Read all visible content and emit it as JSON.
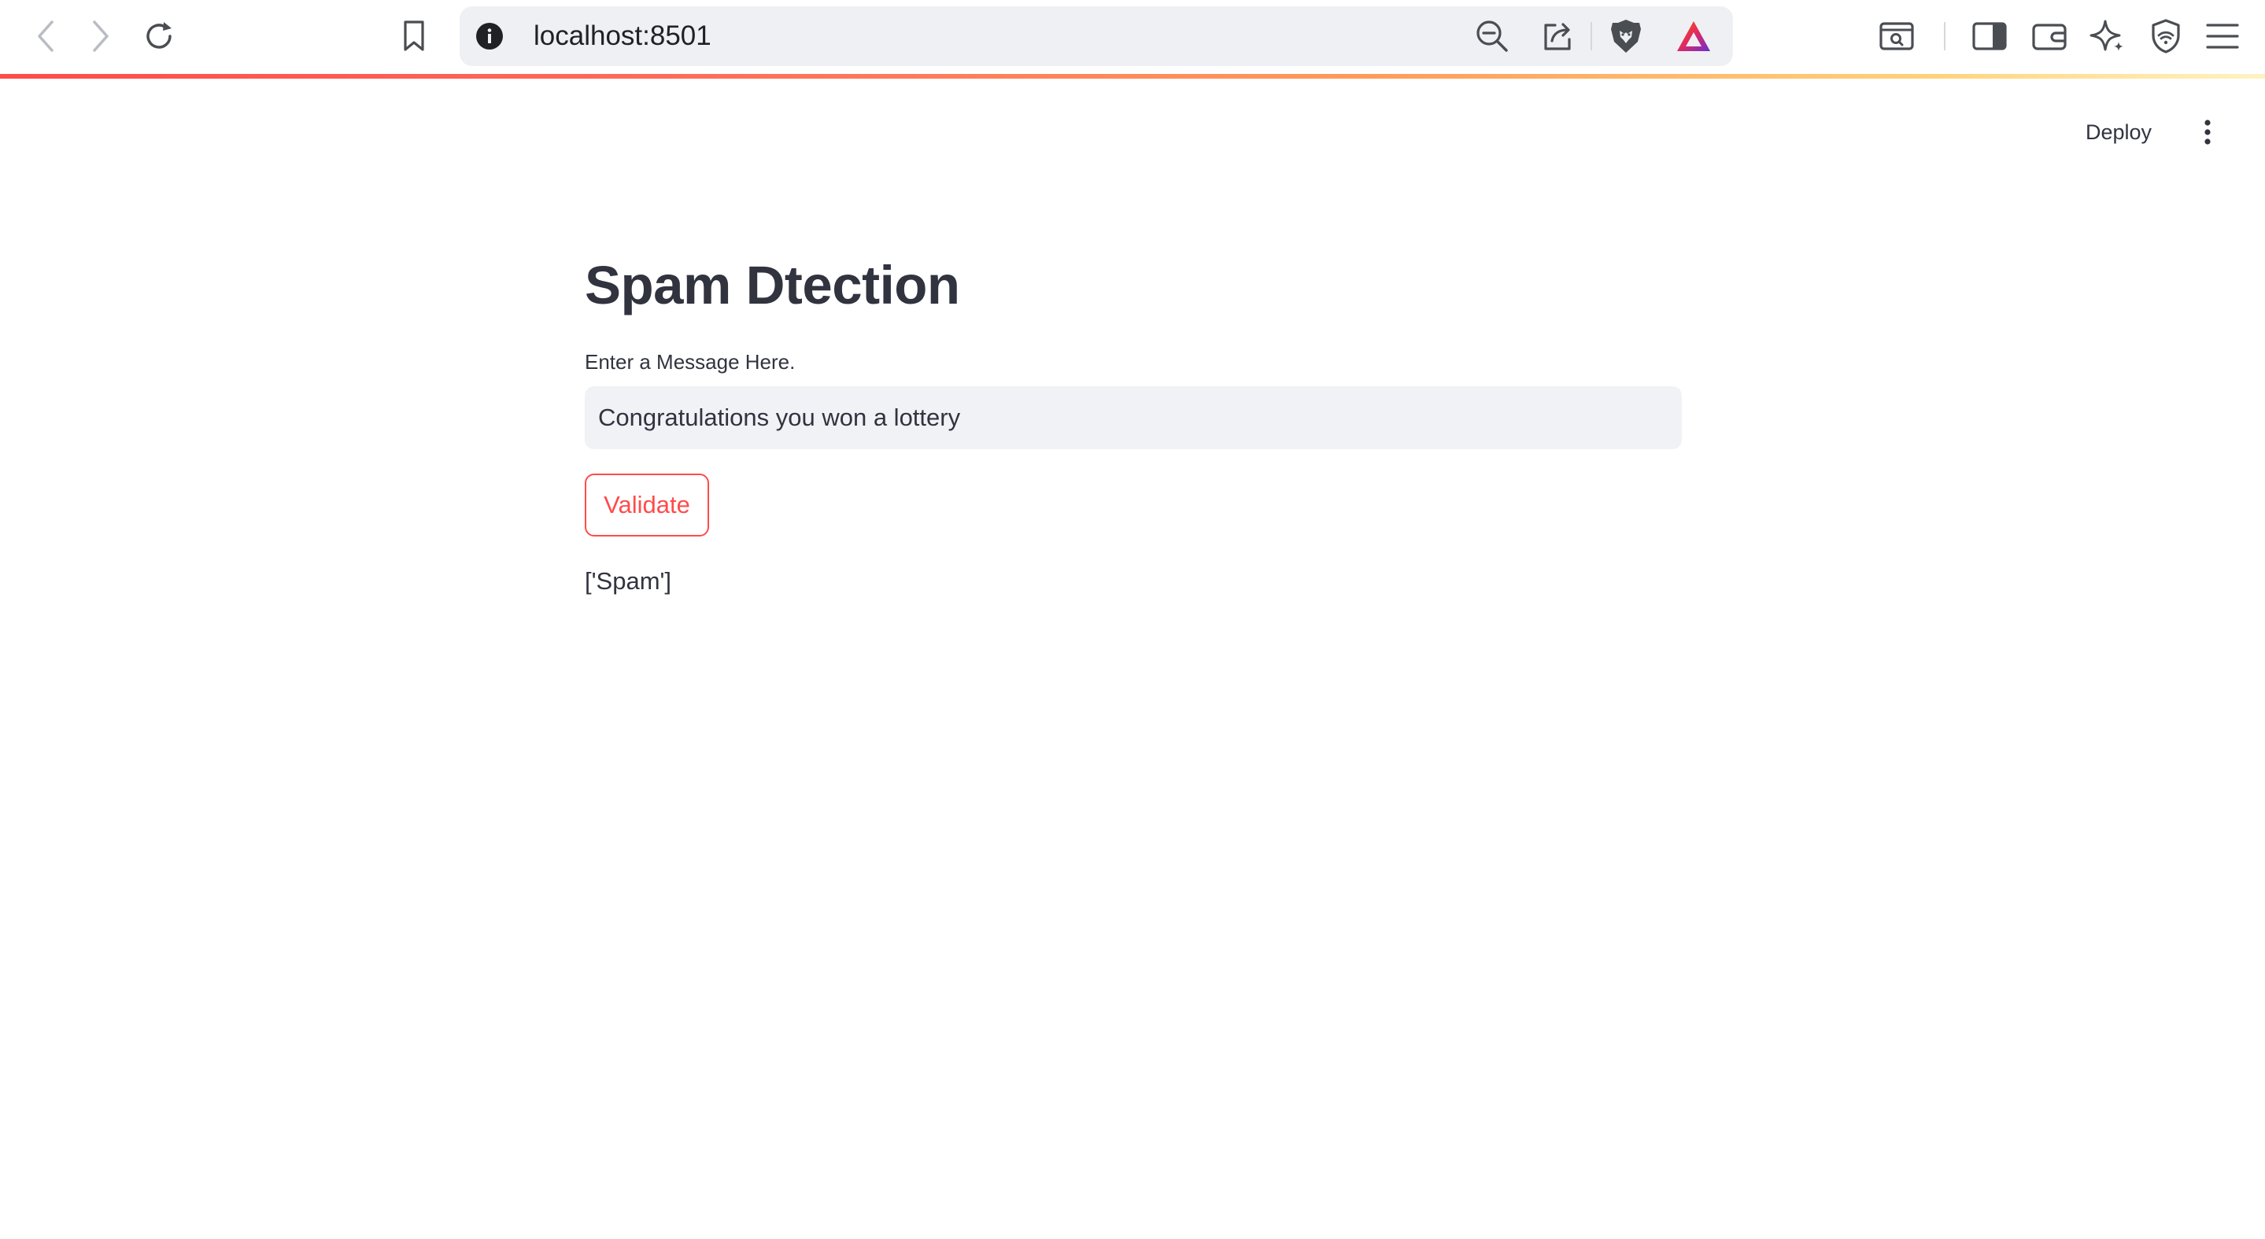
{
  "browser": {
    "url": "localhost:8501",
    "icons": [
      "back-arrow-icon",
      "forward-arrow-icon",
      "reload-icon",
      "bookmark-icon",
      "site-info-icon",
      "zoom-out-icon",
      "share-icon",
      "brave-shields-icon",
      "brave-rewards-icon",
      "tab-search-icon",
      "sidebar-icon",
      "wallet-icon",
      "leo-ai-icon",
      "vpn-icon",
      "menu-icon"
    ],
    "accent_gradient": [
      "#ff4b4b",
      "#ff9a5a",
      "#ffd27a"
    ]
  },
  "app": {
    "deploy_label": "Deploy",
    "title": "Spam Dtection",
    "input_label": "Enter a Message Here.",
    "input_value": "Congratulations you won a lottery",
    "button_label": "Validate",
    "result_text": "['Spam']",
    "colors": {
      "accent": "#ff4b4b",
      "text": "#31333f",
      "input_bg": "#f0f2f6"
    }
  }
}
